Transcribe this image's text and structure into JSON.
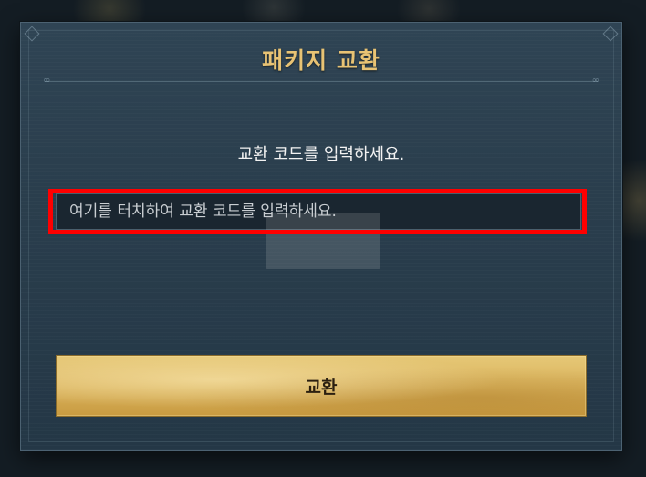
{
  "dialog": {
    "title": "패키지 교환",
    "prompt": "교환 코드를 입력하세요.",
    "code_input": {
      "value": "",
      "placeholder": "여기를 터치하여 교환 코드를 입력하세요."
    },
    "exchange_button_label": "교환"
  },
  "colors": {
    "title_gold": "#e8c374",
    "highlight_red": "#ff0000",
    "button_gold": "#d9b25b",
    "panel_bg": "#2a3e4d"
  },
  "icons": {
    "frame_corner": "diamond-ornament-icon"
  }
}
